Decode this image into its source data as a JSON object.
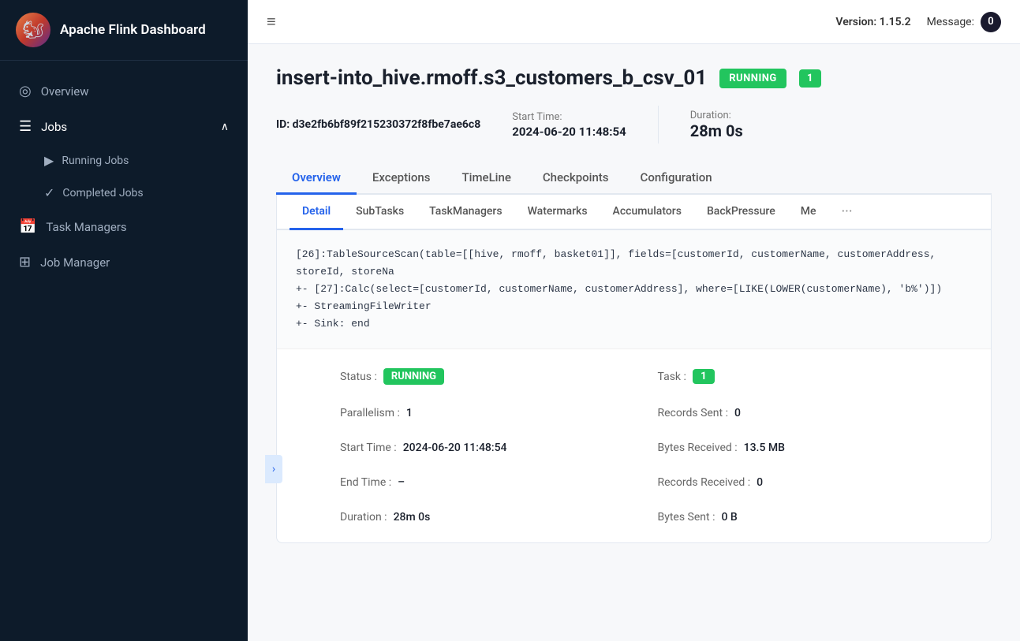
{
  "app": {
    "title": "Apache Flink Dashboard",
    "logo": "🐿",
    "version_label": "Version:",
    "version_value": "1.15.2",
    "message_label": "Message:",
    "message_count": "0"
  },
  "sidebar": {
    "overview_label": "Overview",
    "jobs_label": "Jobs",
    "running_jobs_label": "Running Jobs",
    "completed_jobs_label": "Completed Jobs",
    "task_managers_label": "Task Managers",
    "job_manager_label": "Job Manager"
  },
  "job": {
    "title": "insert-into_hive.rmoff.s3_customers_b_csv_01",
    "status": "RUNNING",
    "task_count": "1",
    "id_label": "ID:",
    "id_value": "d3e2fb6bf89f215230372f8fbe7ae6c8",
    "start_time_label": "Start Time:",
    "start_time_value": "2024-06-20 11:48:54",
    "duration_label": "Duration:",
    "duration_value": "28m 0s"
  },
  "tabs": {
    "overview": "Overview",
    "exceptions": "Exceptions",
    "timeline": "TimeLine",
    "checkpoints": "Checkpoints",
    "configuration": "Configuration"
  },
  "sub_tabs": {
    "detail": "Detail",
    "subtasks": "SubTasks",
    "task_managers": "TaskManagers",
    "watermarks": "Watermarks",
    "accumulators": "Accumulators",
    "back_pressure": "BackPressure",
    "metrics": "Me"
  },
  "code_lines": [
    "[26]:TableSourceScan(table=[[hive, rmoff, basket01]], fields=[customerId, customerName, customerAddress, storeId, storeNa",
    "+- [27]:Calc(select=[customerId, customerName, customerAddress], where=[LIKE(LOWER(customerName), 'b%')])",
    "  +- StreamingFileWriter",
    "    +- Sink: end"
  ],
  "detail_fields": {
    "status_label": "Status :",
    "status_value": "RUNNING",
    "task_label": "Task :",
    "task_value": "1",
    "parallelism_label": "Parallelism :",
    "parallelism_value": "1",
    "records_sent_label": "Records Sent :",
    "records_sent_value": "0",
    "start_time_label": "Start Time :",
    "start_time_value": "2024-06-20 11:48:54",
    "bytes_received_label": "Bytes Received :",
    "bytes_received_value": "13.5 MB",
    "end_time_label": "End Time :",
    "end_time_value": "–",
    "records_received_label": "Records Received :",
    "records_received_value": "0",
    "duration_label": "Duration :",
    "duration_value": "28m 0s",
    "bytes_sent_label": "Bytes Sent :",
    "bytes_sent_value": "0 B"
  }
}
